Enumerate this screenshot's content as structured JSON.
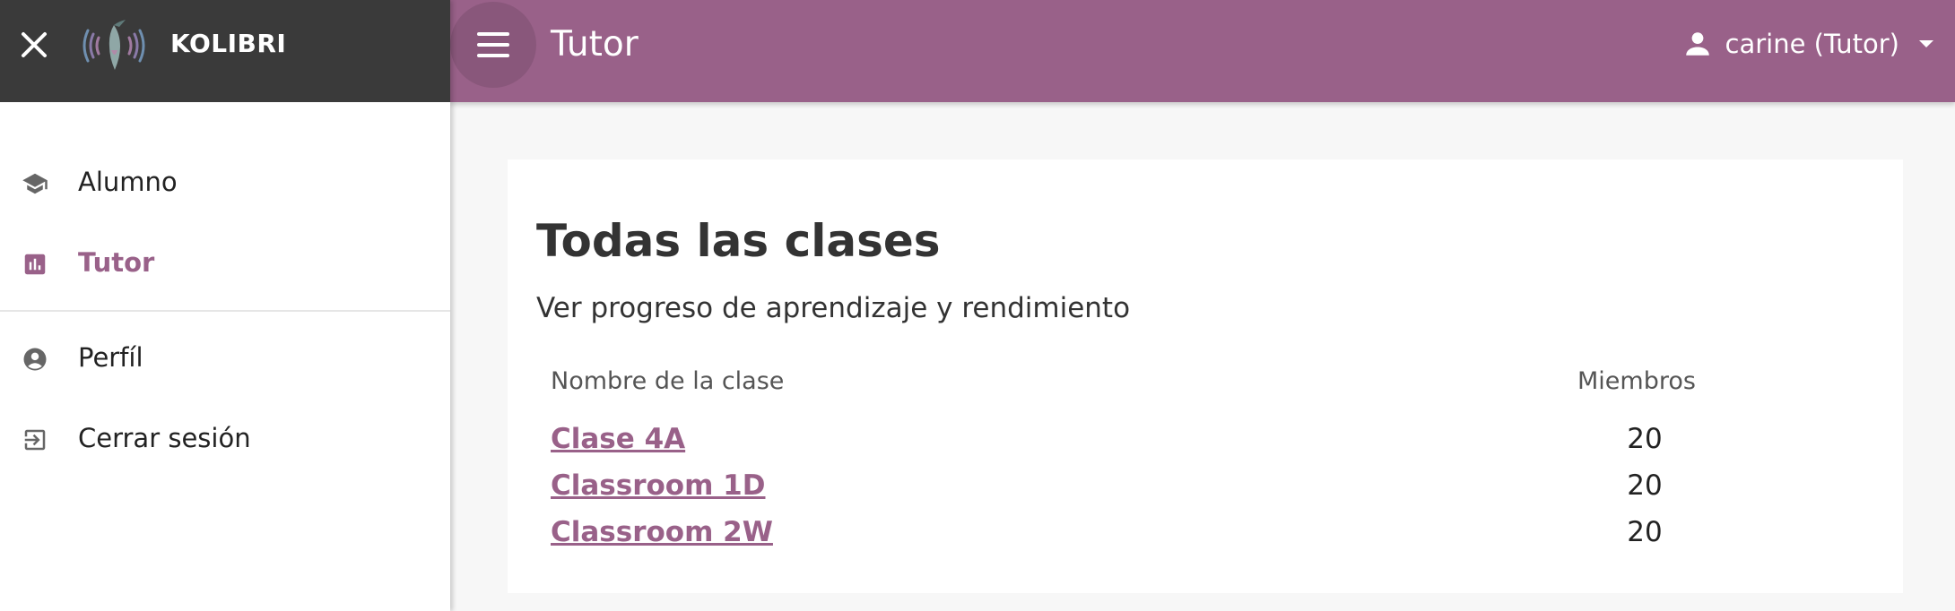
{
  "sidenav": {
    "brand": "KOLIBRI",
    "items": [
      {
        "label": "Alumno"
      },
      {
        "label": "Tutor"
      },
      {
        "label": "Perfíl"
      },
      {
        "label": "Cerrar sesión"
      }
    ]
  },
  "appbar": {
    "title": "Tutor",
    "user_label": "carine (Tutor)"
  },
  "main": {
    "title": "Todas las clases",
    "subtitle": "Ver progreso de aprendizaje y rendimiento",
    "table": {
      "headers": [
        "Nombre de la clase",
        "Miembros"
      ],
      "rows": [
        {
          "name": "Clase 4A",
          "members": "20"
        },
        {
          "name": "Classroom 1D",
          "members": "20"
        },
        {
          "name": "Classroom 2W",
          "members": "20"
        }
      ]
    }
  },
  "colors": {
    "accent": "#996189",
    "sidenav_header": "#3a3a3a",
    "background": "#f7f7f7"
  },
  "icons": [
    "close-icon",
    "kolibri-logo",
    "menu-icon",
    "person-icon",
    "school-cap-icon",
    "bar-chart-icon",
    "account-circle-icon",
    "exit-icon"
  ]
}
